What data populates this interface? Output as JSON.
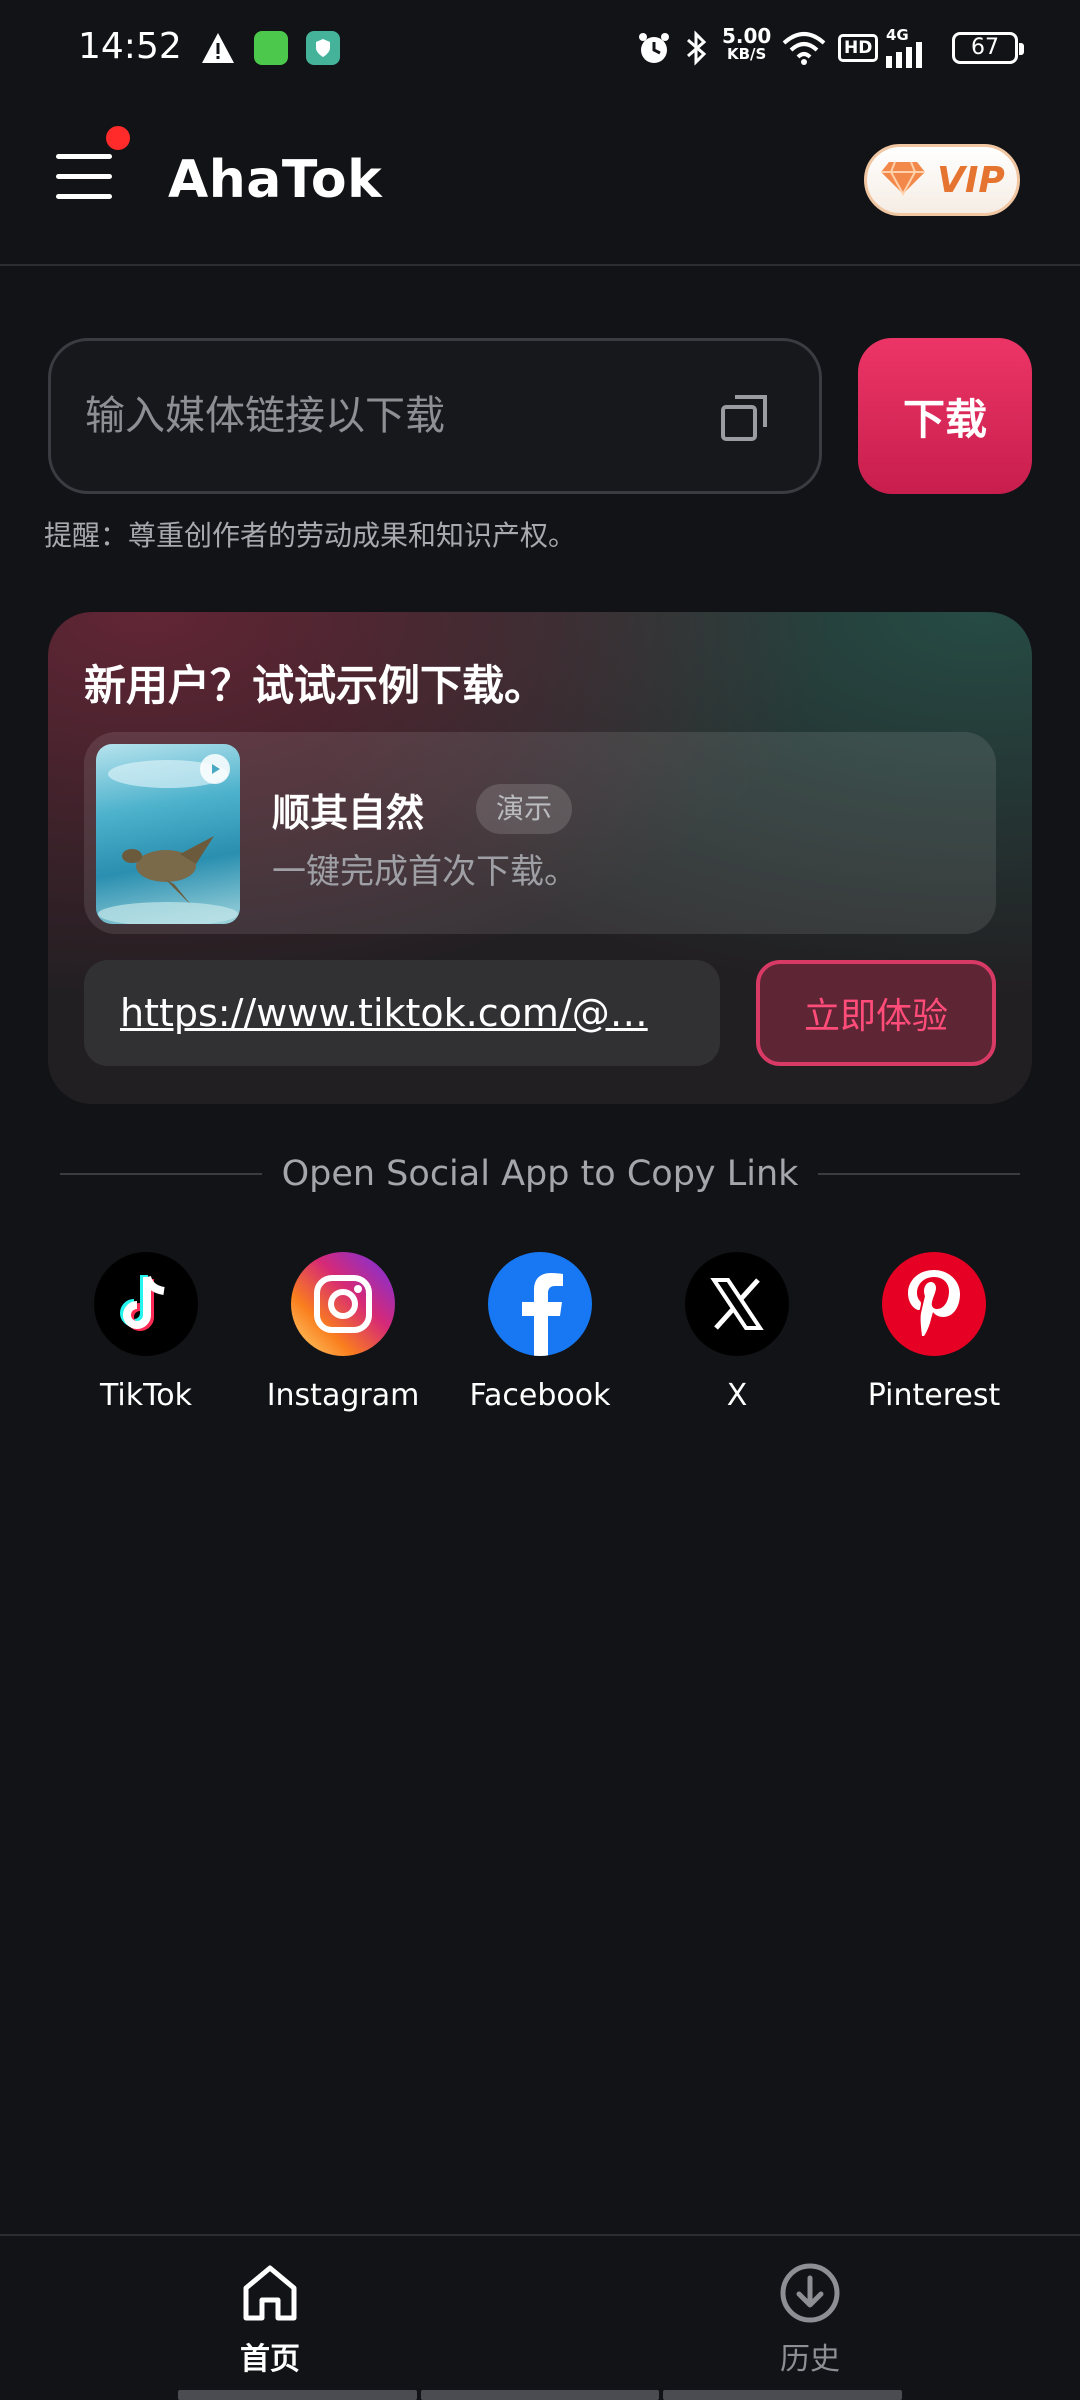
{
  "status_bar": {
    "time": "14:52",
    "net_speed": "5.00",
    "net_speed_unit": "KB/S",
    "hd": "HD",
    "network": "4G",
    "battery": "67",
    "icons": [
      "warning-icon",
      "message-notif-icon",
      "shield-notif-icon",
      "alarm-icon",
      "bluetooth-icon",
      "wifi-icon",
      "signal-icon",
      "battery-icon"
    ]
  },
  "app_bar": {
    "title": "AhaTok",
    "vip_label": "VIP",
    "menu_has_badge": true
  },
  "url_bar": {
    "placeholder": "输入媒体链接以下载",
    "value": "",
    "download_label": "下载",
    "reminder": "提醒：尊重创作者的劳动成果和知识产权。"
  },
  "demo": {
    "title": "新用户？试试示例下载。",
    "item_name": "顺其自然",
    "item_badge": "演示",
    "item_desc": "一键完成首次下载。",
    "url": "https://www.tiktok.com/@…",
    "try_label": "立即体验"
  },
  "social": {
    "heading": "Open Social App to Copy Link",
    "apps": [
      {
        "label": "TikTok",
        "icon": "tiktok-icon"
      },
      {
        "label": "Instagram",
        "icon": "instagram-icon"
      },
      {
        "label": "Facebook",
        "icon": "facebook-icon"
      },
      {
        "label": "X",
        "icon": "x-icon"
      },
      {
        "label": "Pinterest",
        "icon": "pinterest-icon"
      }
    ]
  },
  "bottom_nav": {
    "items": [
      {
        "label": "首页",
        "icon": "home-icon",
        "active": true
      },
      {
        "label": "历史",
        "icon": "history-download-icon",
        "active": false
      }
    ]
  },
  "colors": {
    "background": "#121316",
    "accent": "#e12a5c",
    "vip_orange": "#e4742f",
    "text_secondary": "#a7a9ae"
  }
}
